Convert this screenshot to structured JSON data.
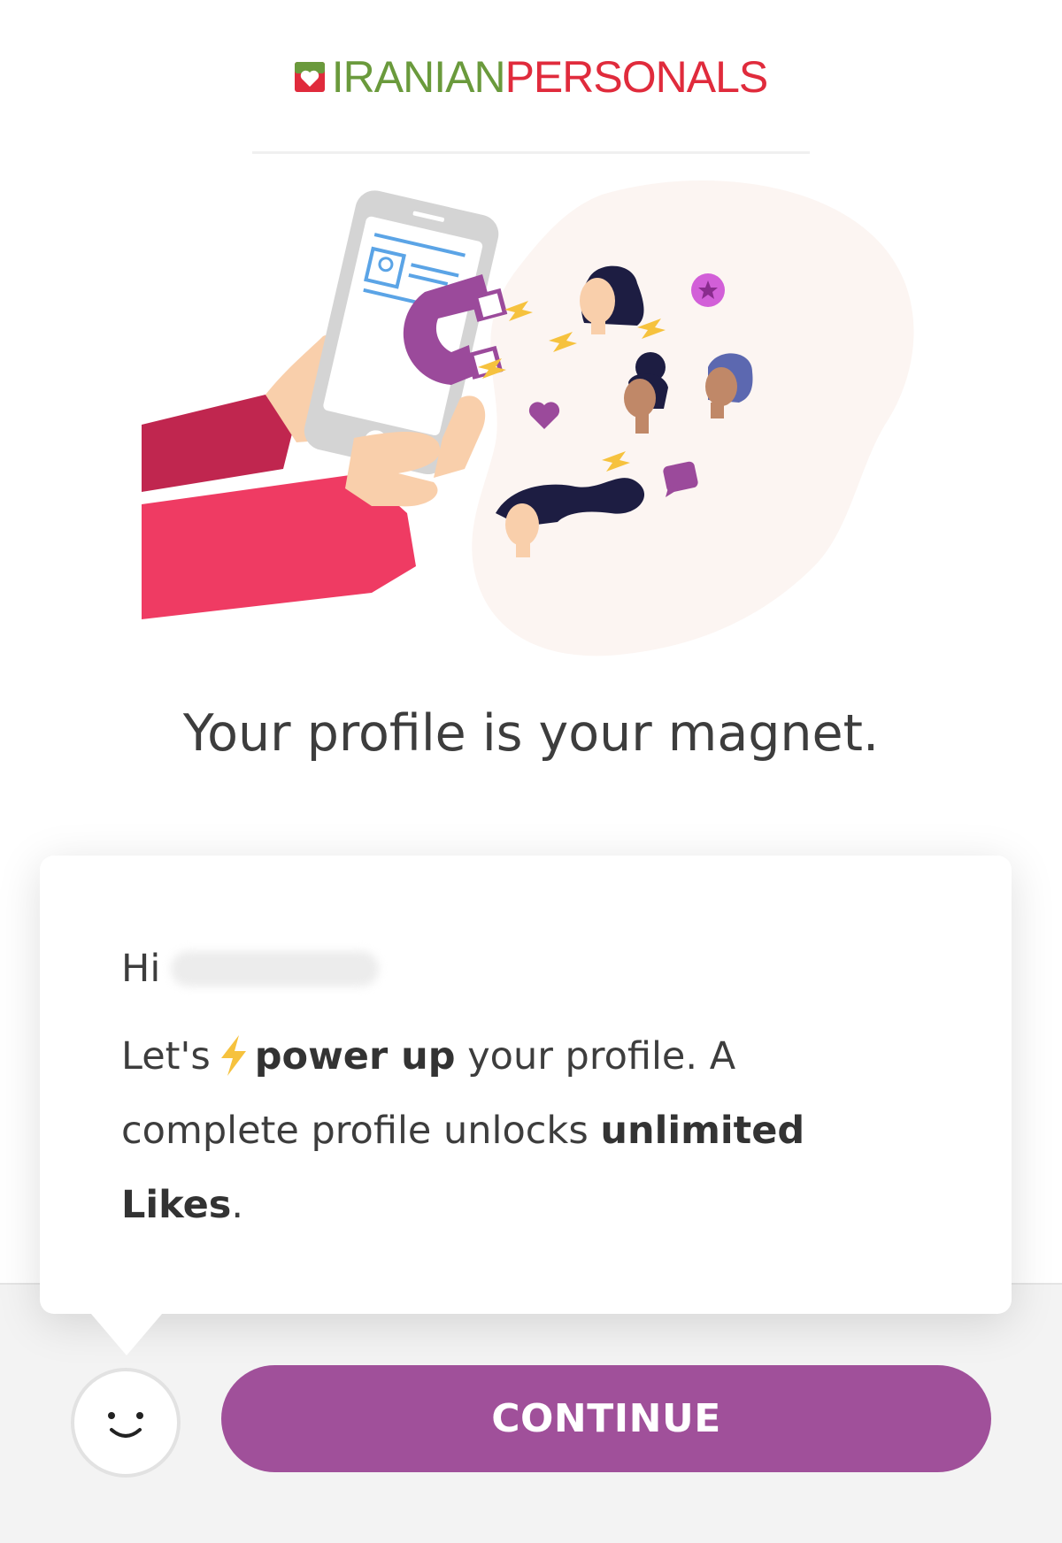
{
  "header": {
    "logo_part1": "IRANIAN",
    "logo_part2": "PERSONALS",
    "logo_color_green": "#6a9a3c",
    "logo_color_red": "#e02b3c"
  },
  "illustration": {
    "icon": "magnet-attracting-profiles-illustration"
  },
  "headline": "Your profile is your magnet.",
  "tooltip": {
    "greeting": "Hi",
    "name_redacted": true,
    "message": {
      "part1": "Let's",
      "bold1": "power up",
      "part2": " your profile. A complete profile unlocks ",
      "bold2": "unlimited Likes",
      "part3": "."
    }
  },
  "footer": {
    "avatar_icon": "smiley-face-icon",
    "continue_label": "CONTINUE",
    "accent_color": "#a0509a"
  }
}
